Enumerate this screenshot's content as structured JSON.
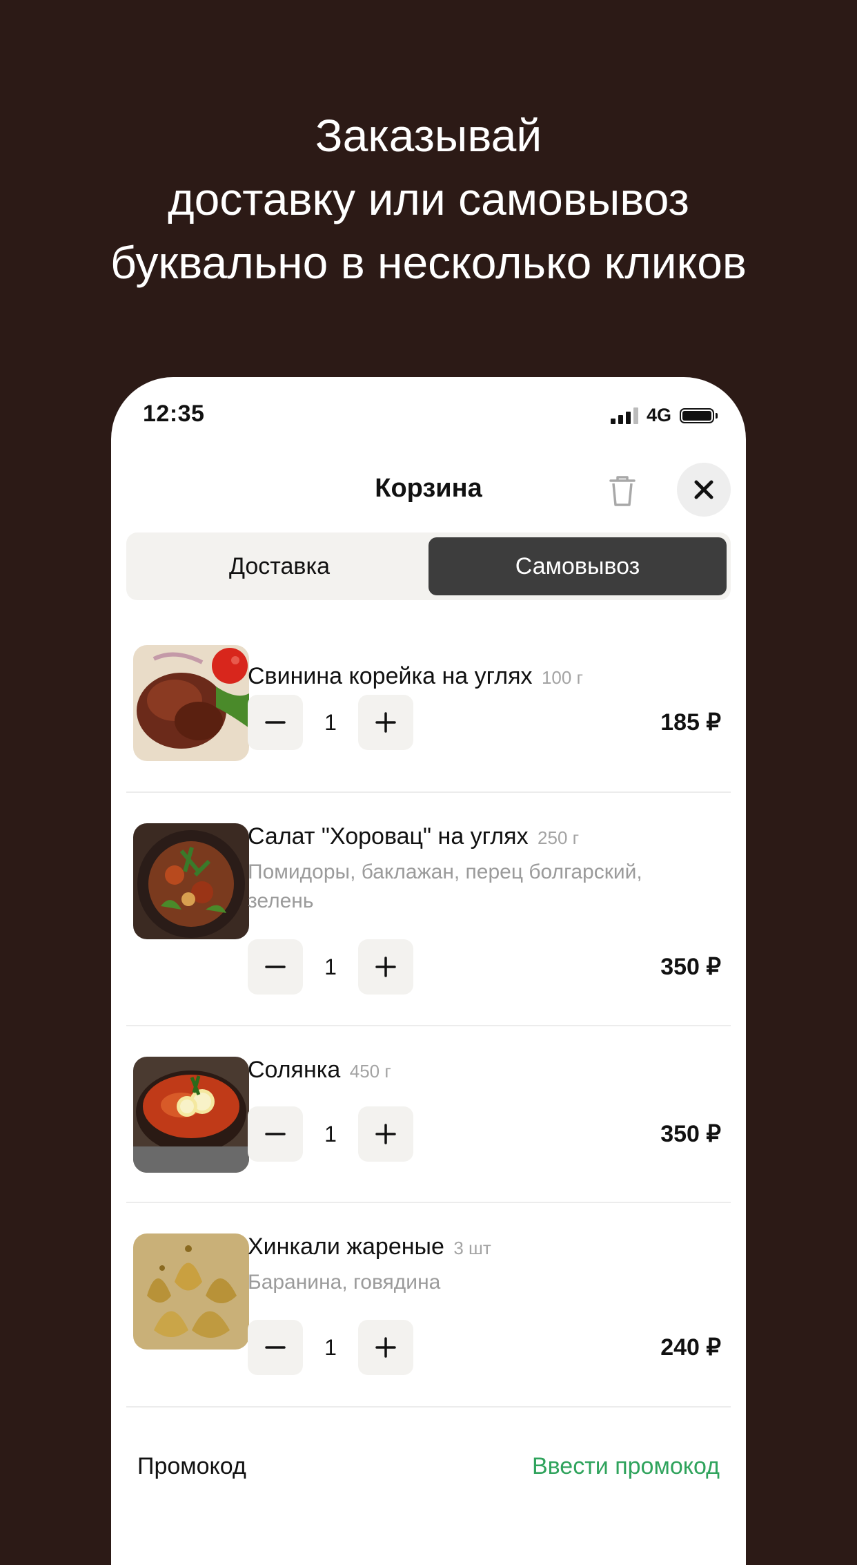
{
  "headline": {
    "line1": "Заказывай",
    "line2": "доставку или самовывоз",
    "line3": "буквально в несколько кликов"
  },
  "status_bar": {
    "time": "12:35",
    "network": "4G"
  },
  "header": {
    "title": "Корзина"
  },
  "tabs": {
    "delivery": "Доставка",
    "pickup": "Самовывоз",
    "selected": "pickup"
  },
  "items": [
    {
      "name": "Свинина корейка на углях",
      "weight": "100 г",
      "description": "",
      "quantity": "1",
      "price": "185 ₽"
    },
    {
      "name": "Салат \"Хоровац\" на углях",
      "weight": "250 г",
      "description": "Помидоры, баклажан, перец болгарский, зелень",
      "quantity": "1",
      "price": "350 ₽"
    },
    {
      "name": "Солянка",
      "weight": "450 г",
      "description": "",
      "quantity": "1",
      "price": "350 ₽"
    },
    {
      "name": "Хинкали жареные",
      "weight": "3 шт",
      "description": "Баранина, говядина",
      "quantity": "1",
      "price": "240 ₽"
    }
  ],
  "promo": {
    "label": "Промокод",
    "link": "Ввести промокод"
  },
  "colors": {
    "background": "#2c1a16",
    "accent_green": "#2fa35c",
    "tab_active": "#3d3d3d"
  }
}
